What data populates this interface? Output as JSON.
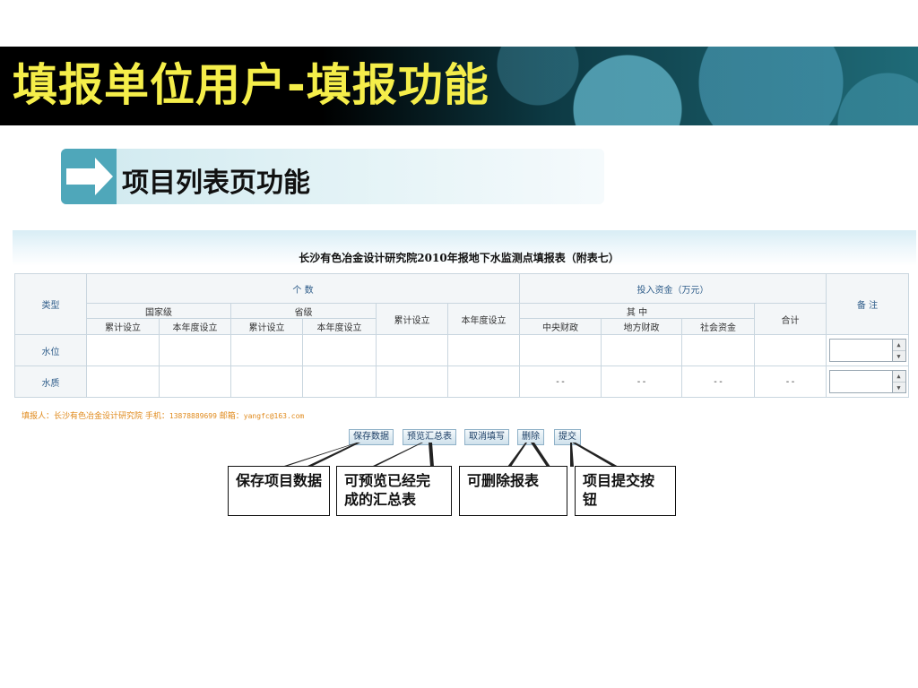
{
  "slide": {
    "title": "填报单位用户-填报功能",
    "subtitle": "项目列表页功能"
  },
  "form": {
    "title": "长沙有色冶金设计研究院2010年报地下水监测点填报表（附表七）",
    "headers": {
      "type": "类型",
      "count": "个  数",
      "national": "国家级",
      "provincial": "省级",
      "cumulative": "累计设立",
      "this_year": "本年度设立",
      "investment": "投入资金（万元）",
      "of_which": "其  中",
      "central": "中央财政",
      "local": "地方财政",
      "social": "社会资金",
      "total": "合计",
      "remarks": "备  注"
    },
    "rows": [
      {
        "label": "水位",
        "values": [
          "",
          "",
          "",
          "",
          "",
          "",
          "",
          "",
          "",
          ""
        ]
      },
      {
        "label": "水质",
        "values": [
          "",
          "",
          "",
          "",
          "",
          "",
          "--",
          "--",
          "--",
          "--"
        ]
      }
    ],
    "filler": {
      "label": "填报人：",
      "org": "长沙有色冶金设计研究院",
      "phone_label": "手机：",
      "phone": "13878889699",
      "email_label": "邮箱：",
      "email": "yangfc@163.com"
    },
    "buttons": {
      "save": "保存数据",
      "preview": "预览汇总表",
      "cancel": "取消填写",
      "delete": "删除",
      "submit": "提交"
    }
  },
  "callouts": {
    "save": "保存项目数据",
    "preview": "可预览已经完成的汇总表",
    "delete": "可删除报表",
    "submit": "项目提交按钮"
  },
  "colors": {
    "title_yellow": "#f5ee4a",
    "filler_orange": "#e08a1c",
    "header_blue": "#2f5d8a"
  },
  "icons": [
    "arrow-right-icon",
    "spinner-up-icon",
    "spinner-down-icon"
  ]
}
